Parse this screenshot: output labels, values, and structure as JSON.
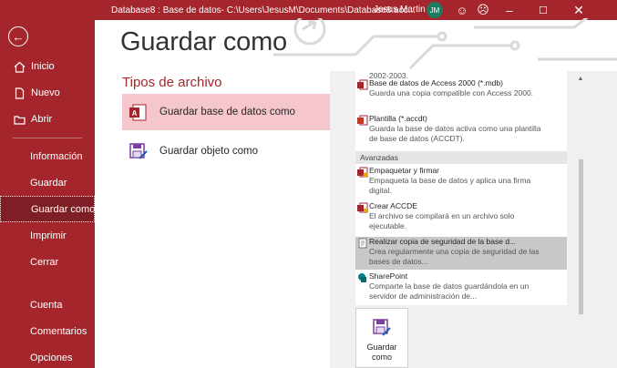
{
  "window": {
    "title": "Database8 : Base de datos- C:\\Users\\JesusM\\Documents\\Database8.acc...",
    "user_name": "Jesus Martin",
    "user_initials": "JM"
  },
  "sidebar": {
    "back_icon": "back-arrow-icon",
    "items": [
      {
        "label": "Inicio",
        "icon": "home-icon"
      },
      {
        "label": "Nuevo",
        "icon": "new-document-icon"
      },
      {
        "label": "Abrir",
        "icon": "open-folder-icon"
      },
      {
        "label": "Información"
      },
      {
        "label": "Guardar"
      },
      {
        "label": "Guardar como",
        "active": true
      },
      {
        "label": "Imprimir"
      },
      {
        "label": "Cerrar"
      },
      {
        "label": "Cuenta"
      },
      {
        "label": "Comentarios"
      },
      {
        "label": "Opciones"
      }
    ]
  },
  "main": {
    "title": "Guardar como",
    "file_types_heading": "Tipos de archivo",
    "file_types": [
      {
        "label": "Guardar base de datos como",
        "selected": true
      },
      {
        "label": "Guardar objeto como",
        "selected": false
      }
    ]
  },
  "options": {
    "cut_top_text": "2002-2003.",
    "items": [
      {
        "title": "Base de datos de Access 2000 (*.mdb)",
        "desc": "Guarda una copia compatible con Access 2000."
      },
      {
        "title": "Plantilla (*.accdt)",
        "desc": "Guarda la base de datos activa como una plantilla de base de datos (ACCDT)."
      }
    ],
    "section_heading": "Avanzadas",
    "advanced": [
      {
        "title": "Empaquetar y firmar",
        "desc": "Empaqueta la base de datos y aplica una firma digital."
      },
      {
        "title": "Crear ACCDE",
        "desc": "El archivo se compilará en un archivo solo ejecutable."
      },
      {
        "title": "Realizar copia de seguridad de la base d...",
        "desc": "Crea regularmente una copia de seguridad de las bases de datos...",
        "highlighted": true
      },
      {
        "title": "SharePoint",
        "desc": "Comparte la base de datos guardándola en un servidor de administración de..."
      }
    ]
  },
  "save_button": {
    "label": "Guardar como"
  },
  "colors": {
    "accent": "#a4262c",
    "active_nav": "#7d1f24",
    "selection": "#f5c6cb",
    "avatar": "#1e7a5f"
  }
}
